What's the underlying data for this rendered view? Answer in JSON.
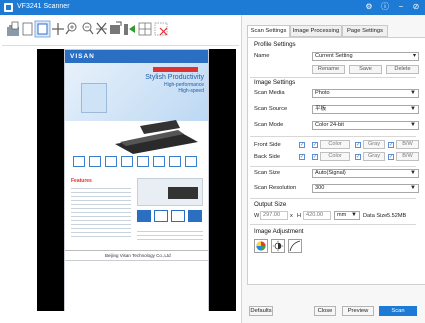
{
  "window": {
    "title": "VF3241 Scanner",
    "controls": [
      "⚙",
      "ⓘ",
      "−",
      "⊘"
    ]
  },
  "toolbar": {
    "tools": [
      "scan-to-folder-icon",
      "single-page-icon",
      "select-area-icon",
      "move-icon",
      "zoom-in-icon",
      "zoom-out-icon",
      "crop-icon",
      "rotate-icon",
      "split-icon",
      "grid-icon",
      "delete-area-icon"
    ]
  },
  "preview": {
    "brand": "VISAN",
    "heading1": "Stylish Productivity",
    "heading2": "High-performance",
    "heading3": "High-speed",
    "features_title": "Features",
    "footer": "Beijing Visan Technology Co.,Ltd"
  },
  "tabs": [
    "Scan Settings",
    "Image Processing",
    "Page Settings"
  ],
  "profile": {
    "title": "Profile Settings",
    "name_label": "Name",
    "name_value": "Current Setting",
    "buttons": [
      "Rename",
      "Save",
      "Delete"
    ]
  },
  "image_settings": {
    "title": "Image Settings",
    "media_label": "Scan Media",
    "media_value": "Photo",
    "source_label": "Scan Source",
    "source_value": "平板",
    "mode_label": "Scan Mode",
    "mode_value": "Color 24-bit"
  },
  "sides": {
    "front_label": "Front Side",
    "back_label": "Back Side",
    "options": [
      "Color",
      "Gray",
      "B/W"
    ]
  },
  "size": {
    "size_label": "Scan Size",
    "size_value": "Auto(Signal)",
    "res_label": "Scan Resolution",
    "res_value": "300"
  },
  "output": {
    "title": "Output Size",
    "w_label": "W",
    "w_value": "297.00",
    "x_label": "x",
    "h_label": "H",
    "h_value": "420.00",
    "unit": "mm",
    "data_size_label": "Data Size",
    "data_size_value": "5.52MB"
  },
  "adjust": {
    "title": "Image Adjustment",
    "icons": [
      "color-wheel-icon",
      "brightness-icon",
      "curve-icon"
    ]
  },
  "bottom": {
    "defaults": "Defaults",
    "close": "Close",
    "preview": "Preview",
    "scan": "Scan"
  }
}
